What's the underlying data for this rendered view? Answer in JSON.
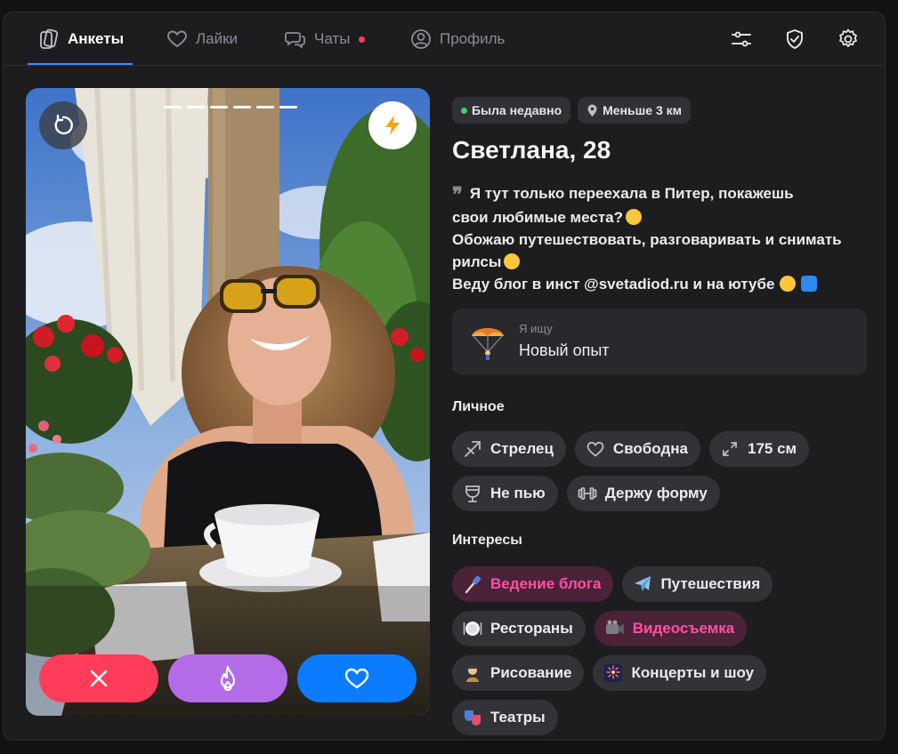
{
  "nav": {
    "tabs": [
      {
        "label": "Анкеты",
        "icon": "cards-icon",
        "active": true
      },
      {
        "label": "Лайки",
        "icon": "heart-icon",
        "active": false
      },
      {
        "label": "Чаты",
        "icon": "chat-icon",
        "active": false,
        "has_unread_dot": true
      },
      {
        "label": "Профиль",
        "icon": "profile-icon",
        "active": false
      }
    ],
    "right_icons": [
      "filters-icon",
      "shield-check-icon",
      "settings-gear-icon"
    ],
    "accent_color": "#3d8bff"
  },
  "card": {
    "photo_count": 6,
    "actions": [
      {
        "name": "dislike",
        "icon": "close-x-icon",
        "color": "#ff3d5a"
      },
      {
        "name": "super-like",
        "icon": "flame-icon",
        "color": "#b36be8"
      },
      {
        "name": "like",
        "icon": "heart-icon",
        "color": "#0b7cff"
      }
    ]
  },
  "profile": {
    "status": "Была недавно",
    "distance": "Меньше 3 км",
    "name_age": "Светлана, 28",
    "bio_lines": [
      "Я тут только переехала в Питер, покажешь",
      "свои любимые места?",
      "Обожаю путешествовать, разговаривать и снимать",
      "рилсы",
      "Веду блог в инст @svetadiod.ru и на ютубе"
    ],
    "seeking_caption": "Я ищу",
    "seeking_value": "Новый опыт"
  },
  "personal": {
    "title": "Личное",
    "items": [
      {
        "label": "Стрелец",
        "icon": "sagittarius-icon"
      },
      {
        "label": "Свободна",
        "icon": "heart-outline-icon"
      },
      {
        "label": "175 см",
        "icon": "height-arrows-icon"
      },
      {
        "label": "Не пью",
        "icon": "glass-icon"
      },
      {
        "label": "Держу форму",
        "icon": "dumbbell-icon"
      }
    ]
  },
  "interests": {
    "title": "Интересы",
    "items": [
      {
        "label": "Ведение блога",
        "icon": "selfie-stick-icon",
        "highlighted": true
      },
      {
        "label": "Путешествия",
        "icon": "airplane-icon",
        "highlighted": false
      },
      {
        "label": "Рестораны",
        "icon": "plate-icon",
        "highlighted": false
      },
      {
        "label": "Видеосъемка",
        "icon": "video-camera-icon",
        "highlighted": true
      },
      {
        "label": "Рисование",
        "icon": "artist-icon",
        "highlighted": false
      },
      {
        "label": "Концерты и шоу",
        "icon": "fireworks-icon",
        "highlighted": false
      },
      {
        "label": "Театры",
        "icon": "theater-masks-icon",
        "highlighted": false
      }
    ]
  }
}
